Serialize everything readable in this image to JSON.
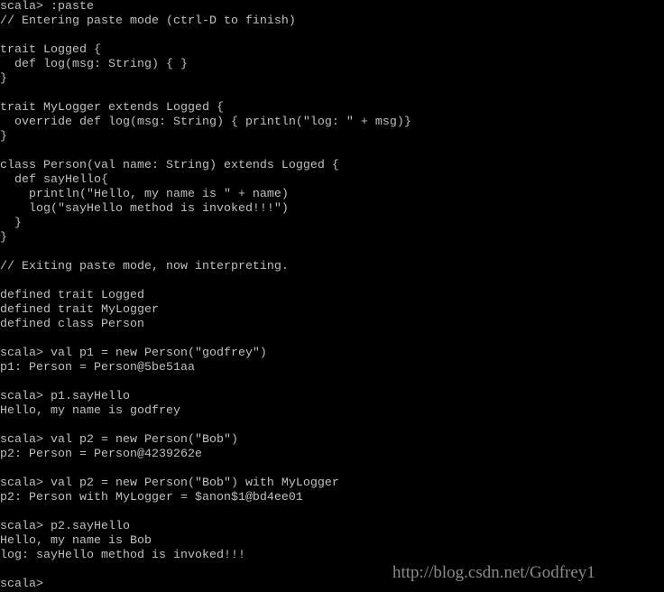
{
  "terminal": {
    "lines": [
      "scala> :paste",
      "// Entering paste mode (ctrl-D to finish)",
      "",
      "trait Logged {",
      "  def log(msg: String) { }",
      "}",
      "",
      "trait MyLogger extends Logged {",
      "  override def log(msg: String) { println(\"log: \" + msg)}",
      "}",
      "",
      "class Person(val name: String) extends Logged {",
      "  def sayHello{",
      "    println(\"Hello, my name is \" + name)",
      "    log(\"sayHello method is invoked!!!\")",
      "  }",
      "}",
      "",
      "// Exiting paste mode, now interpreting.",
      "",
      "defined trait Logged",
      "defined trait MyLogger",
      "defined class Person",
      "",
      "scala> val p1 = new Person(\"godfrey\")",
      "p1: Person = Person@5be51aa",
      "",
      "scala> p1.sayHello",
      "Hello, my name is godfrey",
      "",
      "scala> val p2 = new Person(\"Bob\")",
      "p2: Person = Person@4239262e",
      "",
      "scala> val p2 = new Person(\"Bob\") with MyLogger",
      "p2: Person with MyLogger = $anon$1@bd4ee01",
      "",
      "scala> p2.sayHello",
      "Hello, my name is Bob",
      "log: sayHello method is invoked!!!",
      "",
      "scala> "
    ]
  },
  "watermark": "http://blog.csdn.net/Godfrey1",
  "colors": {
    "background": "#000000",
    "text": "#c0c0c0"
  }
}
